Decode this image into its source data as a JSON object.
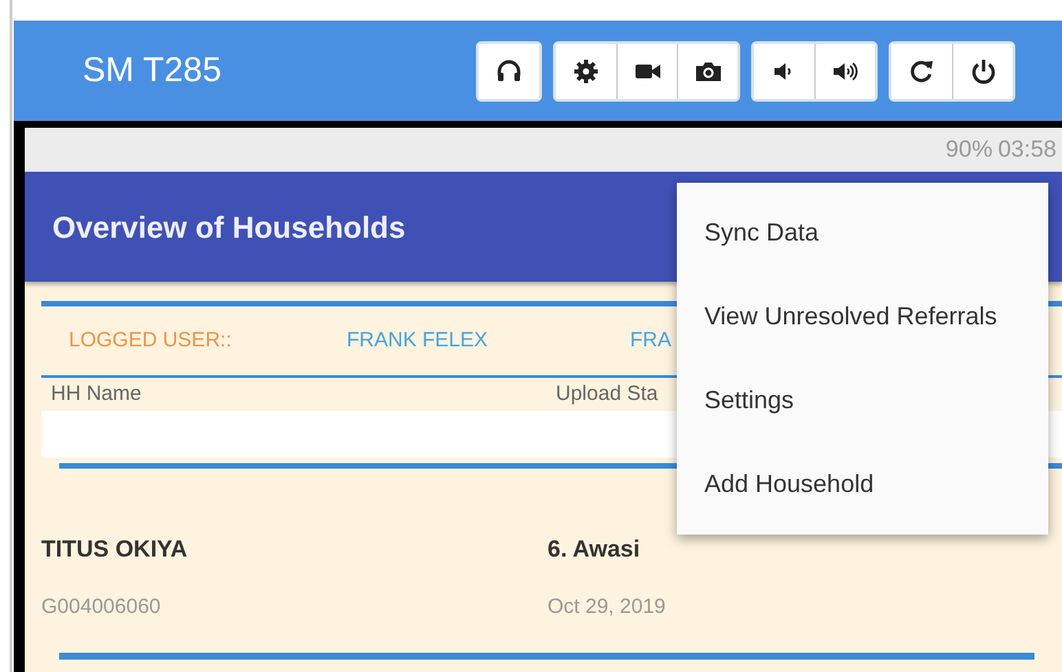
{
  "device_bar": {
    "title": "SM T285"
  },
  "status_bar": {
    "battery": "90%",
    "time": "03:58"
  },
  "app_bar": {
    "title": "Overview of Households"
  },
  "logged_user": {
    "label": "LOGGED USER::",
    "values": [
      "FRANK FELEX",
      "FRA"
    ]
  },
  "table": {
    "columns": [
      "HH Name",
      "Upload Sta"
    ],
    "rows": [
      {
        "name": "TITUS OKIYA",
        "id": "G004006060",
        "village": "6. Awasi",
        "date": "Oct 29, 2019"
      }
    ]
  },
  "menu": {
    "items": [
      "Sync Data",
      "View Unresolved Referrals",
      "Settings",
      "Add Household"
    ]
  }
}
